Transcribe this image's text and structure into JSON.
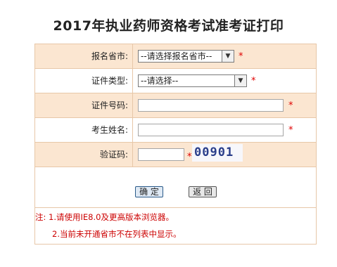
{
  "page": {
    "title": "2017年执业药师资格考试准考证打印"
  },
  "form": {
    "province": {
      "label": "报名省市:",
      "selected": "--请选择报名省市--",
      "required": "*"
    },
    "id_type": {
      "label": "证件类型:",
      "selected": "--请选择--",
      "required": "*"
    },
    "id_number": {
      "label": "证件号码:",
      "value": "",
      "required": "*"
    },
    "name": {
      "label": "考生姓名:",
      "value": "",
      "required": "*"
    },
    "captcha": {
      "label": "验证码:",
      "value": "",
      "required": "*",
      "image_text": "00901"
    }
  },
  "actions": {
    "confirm_label": "确 定",
    "back_label": "返 回"
  },
  "notes": {
    "line1": "注: 1.请使用IE8.0及更高版本浏览器。",
    "line2": "2.当前未开通省市不在列表中显示。"
  },
  "colors": {
    "row_highlight": "#fbe6d1",
    "border": "#e7c7a8",
    "required": "#e00000",
    "note_text": "#cc0000"
  }
}
